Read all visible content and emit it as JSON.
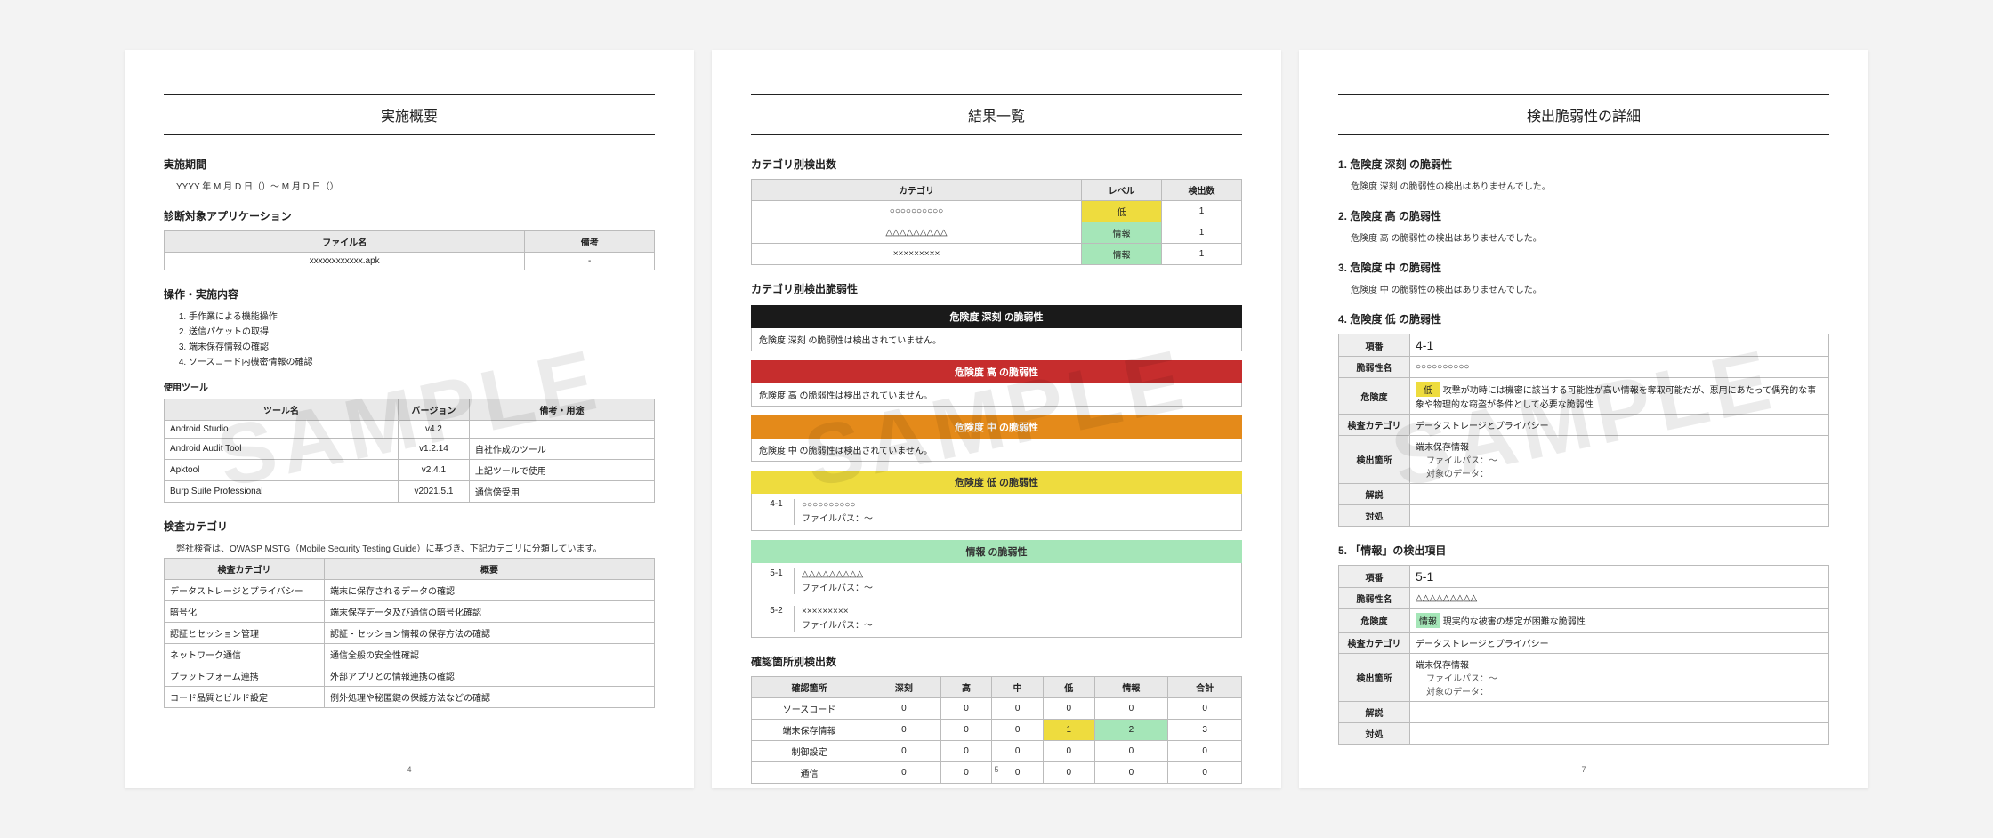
{
  "watermark": "SAMPLE",
  "page4": {
    "title": "実施概要",
    "periodLabel": "実施期間",
    "periodValue": "YYYY 年 M 月 D 日（）～ M 月 D 日（）",
    "appLabel": "診断対象アプリケーション",
    "appTable": {
      "hFile": "ファイル名",
      "hRemark": "備考",
      "file": "xxxxxxxxxxxx.apk",
      "remark": "-"
    },
    "opsLabel": "操作・実施内容",
    "ops": [
      "手作業による機能操作",
      "送信パケットの取得",
      "端末保存情報の確認",
      "ソースコード内機密情報の確認"
    ],
    "toolLabel": "使用ツール",
    "toolTable": {
      "hName": "ツール名",
      "hVer": "バージョン",
      "hNote": "備考・用途",
      "rows": [
        {
          "n": "Android Studio",
          "v": "v4.2",
          "r": ""
        },
        {
          "n": "Android Audit Tool",
          "v": "v1.2.14",
          "r": "自社作成のツール"
        },
        {
          "n": "Apktool",
          "v": "v2.4.1",
          "r": "上記ツールで使用"
        },
        {
          "n": "Burp Suite Professional",
          "v": "v2021.5.1",
          "r": "通信傍受用"
        }
      ]
    },
    "catLabel": "検査カテゴリ",
    "catIntro": "弊社検査は、OWASP MSTG（Mobile Security Testing Guide）に基づき、下記カテゴリに分類しています。",
    "catTable": {
      "hCat": "検査カテゴリ",
      "hDesc": "概要",
      "rows": [
        {
          "c": "データストレージとプライバシー",
          "d": "端末に保存されるデータの確認"
        },
        {
          "c": "暗号化",
          "d": "端末保存データ及び通信の暗号化確認"
        },
        {
          "c": "認証とセッション管理",
          "d": "認証・セッション情報の保存方法の確認"
        },
        {
          "c": "ネットワーク通信",
          "d": "通信全般の安全性確認"
        },
        {
          "c": "プラットフォーム連携",
          "d": "外部アプリとの情報連携の確認"
        },
        {
          "c": "コード品質とビルド設定",
          "d": "例外処理や秘匿鍵の保護方法などの確認"
        }
      ]
    },
    "pageNum": "4"
  },
  "page5": {
    "title": "結果一覧",
    "byCatLabel": "カテゴリ別検出数",
    "catCount": {
      "hCat": "カテゴリ",
      "hLvl": "レベル",
      "hCnt": "検出数",
      "rows": [
        {
          "c": "○○○○○○○○○○",
          "lvl": "低",
          "lvlClass": "lvl-low",
          "n": "1"
        },
        {
          "c": "△△△△△△△△△",
          "lvl": "情報",
          "lvlClass": "lvl-info",
          "n": "1"
        },
        {
          "c": "×××××××××",
          "lvl": "情報",
          "lvlClass": "lvl-info",
          "n": "1"
        }
      ]
    },
    "byCatVulnLabel": "カテゴリ別検出脆弱性",
    "sev": {
      "critical": {
        "bar": "危険度 深刻 の脆弱性",
        "note": "危険度 深刻 の脆弱性は検出されていません。"
      },
      "high": {
        "bar": "危険度 高 の脆弱性",
        "note": "危険度 高 の脆弱性は検出されていません。"
      },
      "mid": {
        "bar": "危険度 中 の脆弱性",
        "note": "危険度 中 の脆弱性は検出されていません。"
      },
      "low": {
        "bar": "危険度 低 の脆弱性",
        "items": [
          {
            "idx": "4-1",
            "l1": "○○○○○○○○○○",
            "l2": "ファイルパス：～"
          }
        ]
      },
      "info": {
        "bar": "情報 の脆弱性",
        "items": [
          {
            "idx": "5-1",
            "l1": "△△△△△△△△△",
            "l2": "ファイルパス：～"
          },
          {
            "idx": "5-2",
            "l1": "×××××××××",
            "l2": "ファイルパス：～"
          }
        ]
      }
    },
    "byLocLabel": "確認箇所別検出数",
    "locTable": {
      "hLoc": "確認箇所",
      "hCri": "深刻",
      "hHi": "高",
      "hMid": "中",
      "hLow": "低",
      "hInfo": "情報",
      "hSum": "合計",
      "rows": [
        {
          "loc": "ソースコード",
          "v": [
            "0",
            "0",
            "0",
            "0",
            "0",
            "0"
          ]
        },
        {
          "loc": "端末保存情報",
          "v": [
            "0",
            "0",
            "0",
            "1",
            "2",
            "3"
          ],
          "hl": [
            false,
            false,
            false,
            true,
            true,
            false
          ]
        },
        {
          "loc": "制御設定",
          "v": [
            "0",
            "0",
            "0",
            "0",
            "0",
            "0"
          ]
        },
        {
          "loc": "通信",
          "v": [
            "0",
            "0",
            "0",
            "0",
            "0",
            "0"
          ]
        }
      ]
    },
    "pageNum": "5"
  },
  "page7": {
    "title": "検出脆弱性の詳細",
    "s1": {
      "h": "1. 危険度 深刻 の脆弱性",
      "t": "危険度 深刻 の脆弱性の検出はありませんでした。"
    },
    "s2": {
      "h": "2. 危険度 高 の脆弱性",
      "t": "危険度 高 の脆弱性の検出はありませんでした。"
    },
    "s3": {
      "h": "3. 危険度 中 の脆弱性",
      "t": "危険度 中 の脆弱性の検出はありませんでした。"
    },
    "s4": {
      "h": "4. 危険度 低 の脆弱性"
    },
    "labels": {
      "no": "項番",
      "name": "脆弱性名",
      "risk": "危険度",
      "cat": "検査カテゴリ",
      "loc": "検出箇所",
      "desc": "解説",
      "fix": "対処",
      "path": "ファイルパス：～",
      "tgt": "対象のデータ：",
      "riskNote4": "攻撃が功時には機密に該当する可能性が高い情報を奪取可能だが、悪用にあたって偶発的な事象や物理的な窃盗が条件として必要な脆弱性",
      "riskNote5": "現実的な被害の想定が困難な脆弱性"
    },
    "d4": {
      "no": "4-1",
      "name": "○○○○○○○○○○",
      "risk": "低",
      "riskClass": "lvl-low",
      "cat": "データストレージとプライバシー",
      "loc": "端末保存情報"
    },
    "s5": {
      "h": "5. 「情報」の検出項目"
    },
    "d5": {
      "no": "5-1",
      "name": "△△△△△△△△△",
      "risk": "情報",
      "riskClass": "lvl-info",
      "cat": "データストレージとプライバシー",
      "loc": "端末保存情報"
    },
    "pageNum": "7"
  }
}
